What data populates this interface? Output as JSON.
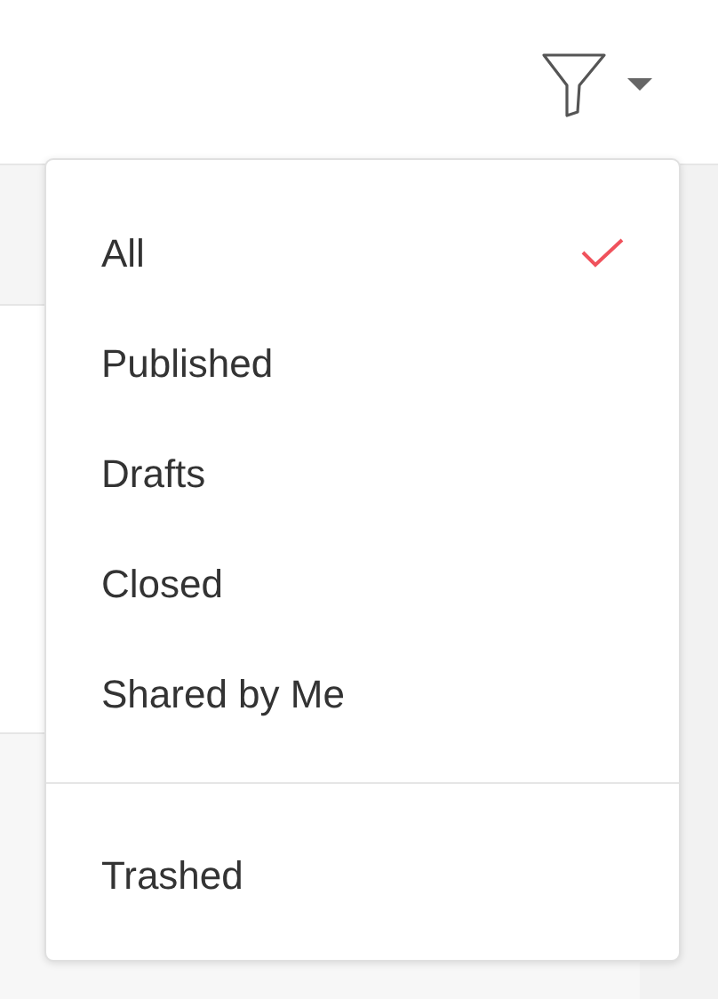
{
  "menu": {
    "items": [
      {
        "label": "All",
        "selected": true
      },
      {
        "label": "Published",
        "selected": false
      },
      {
        "label": "Drafts",
        "selected": false
      },
      {
        "label": "Closed",
        "selected": false
      },
      {
        "label": "Shared by Me",
        "selected": false
      }
    ],
    "footer_items": [
      {
        "label": "Trashed",
        "selected": false
      }
    ]
  }
}
